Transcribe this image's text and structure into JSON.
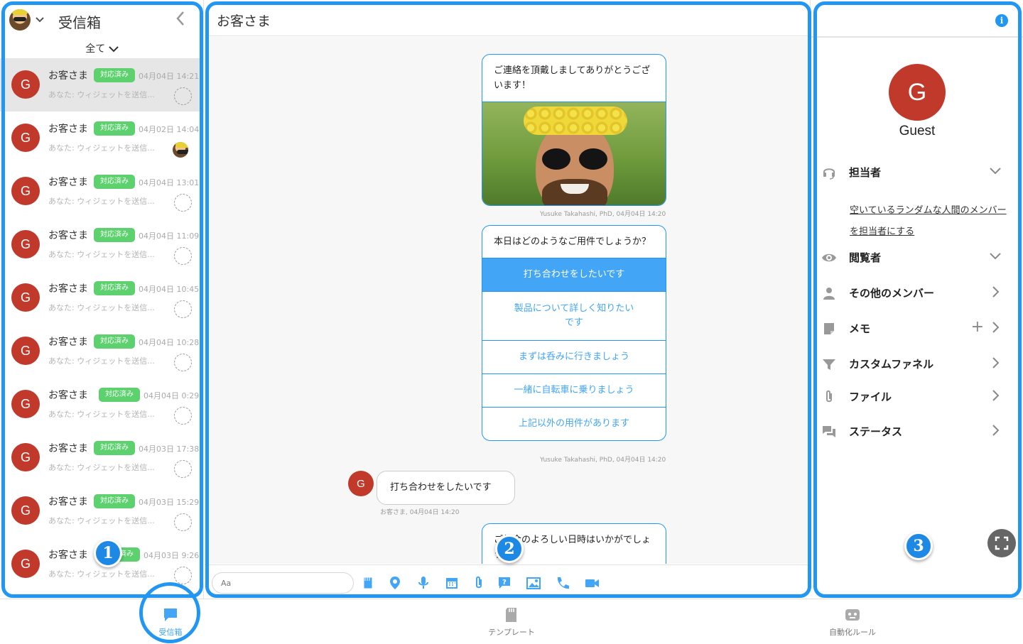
{
  "colors": {
    "accent": "#2196f3",
    "badge_green": "#5cd16e",
    "guest_red": "#c0392b"
  },
  "inbox": {
    "title": "受信箱",
    "filter": "全て",
    "conversations": [
      {
        "name": "お客さま",
        "badge": "対応済み",
        "time": "04月04日 14:21",
        "preview": "あなた: ウィジェットを送信...",
        "assignee": "empty",
        "selected": true
      },
      {
        "name": "お客さま",
        "badge": "対応済み",
        "time": "04月02日 14:04",
        "preview": "あなた: ウィジェットを送信...",
        "assignee": "photo"
      },
      {
        "name": "お客さま",
        "badge": "対応済み",
        "time": "04月04日 13:01",
        "preview": "あなた: ウィジェットを送信...",
        "assignee": "empty"
      },
      {
        "name": "お客さま",
        "badge": "対応済み",
        "time": "04月04日 11:09",
        "preview": "あなた: ウィジェットを送信...",
        "assignee": "empty"
      },
      {
        "name": "お客さま",
        "badge": "対応済み",
        "time": "04月04日 10:45",
        "preview": "あなた: ウィジェットを送信...",
        "assignee": "empty"
      },
      {
        "name": "お客さま",
        "badge": "対応済み",
        "time": "04月04日 10:28",
        "preview": "あなた: ウィジェットを送信...",
        "assignee": "empty"
      },
      {
        "name": "お客さま",
        "badge": "対応済み",
        "time": "04月04日 0:29",
        "preview": "あなた: ウィジェットを送信...",
        "assignee": "empty"
      },
      {
        "name": "お客さま",
        "badge": "対応済み",
        "time": "04月03日 17:38",
        "preview": "あなた: ウィジェットを送信...",
        "assignee": "empty"
      },
      {
        "name": "お客さま",
        "badge": "対応済み",
        "time": "04月03日 15:29",
        "preview": "あなた: ウィジェットを送信...",
        "assignee": "empty"
      },
      {
        "name": "お客さま",
        "badge": "対応済み",
        "time": "04月03日 9:26",
        "preview": "あなた: ウィジェットを送信...",
        "assignee": "empty"
      }
    ],
    "avatar_letter": "G"
  },
  "chat": {
    "title": "お客さま",
    "msg1": {
      "text": "ご連絡を頂戴しましてありがとうございます！",
      "meta": "Yusuke Takahashi, PhD, 04月04日 14:20"
    },
    "msg2": {
      "text": "本日はどのようなご用件でしょうか？",
      "options": [
        "打ち合わせをしたいです",
        "製品について詳しく知りたいです",
        "まずは呑みに行きましょう",
        "一緒に自転車に乗りましょう",
        "上記以外の用件があります"
      ],
      "meta": "Yusuke Takahashi, PhD, 04月04日 14:20"
    },
    "reply": {
      "text": "打ち合わせをしたいです",
      "meta": "お客さま, 04月04日 14:20",
      "avatar": "G"
    },
    "msg3": {
      "text": "ご都合のよろしい日時はいかがでしょうか？"
    },
    "input_placeholder": "Aa",
    "tools": [
      "sticker-icon",
      "location-icon",
      "mic-icon",
      "calendar-icon",
      "attachment-icon",
      "question-icon",
      "image-icon",
      "phone-icon",
      "video-icon"
    ]
  },
  "details": {
    "avatar": "G",
    "name": "Guest",
    "sections": {
      "assignee": "担当者",
      "viewer": "閲覧者",
      "members": "その他のメンバー",
      "memo": "メモ",
      "funnel": "カスタムファネル",
      "file": "ファイル",
      "status": "ステータス"
    },
    "assign_link": "空いているランダムな人間のメンバーを担当者にする"
  },
  "bottom_nav": [
    {
      "label": "受信箱",
      "icon": "chat-bubble-icon",
      "active": true
    },
    {
      "label": "テンプレート",
      "icon": "template-icon",
      "active": false
    },
    {
      "label": "自動化ルール",
      "icon": "robot-icon",
      "active": false
    }
  ],
  "annotations": [
    "1",
    "2",
    "3"
  ]
}
